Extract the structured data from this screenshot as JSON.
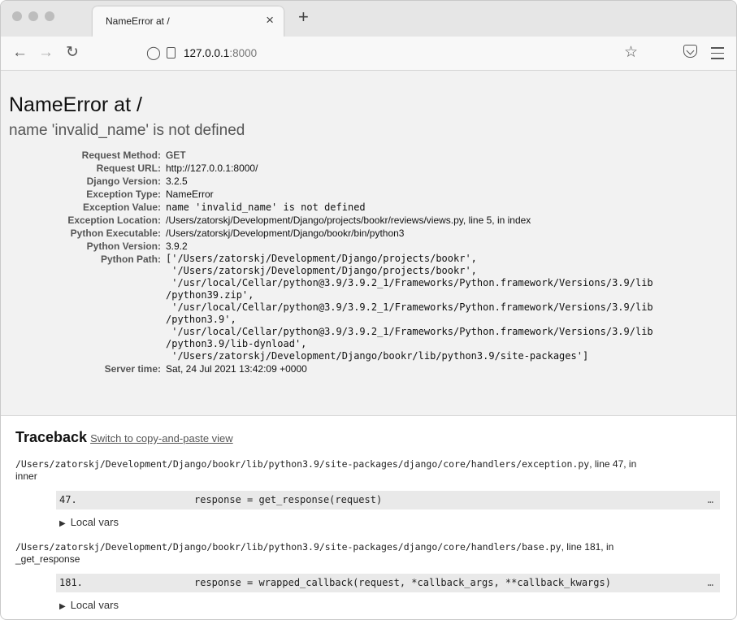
{
  "browser": {
    "tab_title": "NameError at /",
    "tab_close": "×",
    "new_tab": "+",
    "url_host": "127.0.0.1",
    "url_port": ":8000",
    "icons": [
      "back-arrow-icon",
      "forward-arrow-icon",
      "reload-icon",
      "shield-icon",
      "page-icon",
      "bookmark-star-icon",
      "pocket-icon",
      "hamburger-menu-icon"
    ]
  },
  "error": {
    "title": "NameError at /",
    "message": "name 'invalid_name' is not defined"
  },
  "meta": [
    {
      "label": "Request Method:",
      "value": "GET"
    },
    {
      "label": "Request URL:",
      "value": "http://127.0.0.1:8000/"
    },
    {
      "label": "Django Version:",
      "value": "3.2.5"
    },
    {
      "label": "Exception Type:",
      "value": "NameError"
    },
    {
      "label": "Exception Value:",
      "value": "name 'invalid_name' is not defined"
    },
    {
      "label": "Exception Location:",
      "value": "/Users/zatorskj/Development/Django/projects/bookr/reviews/views.py, line 5, in index"
    },
    {
      "label": "Python Executable:",
      "value": "/Users/zatorskj/Development/Django/bookr/bin/python3"
    },
    {
      "label": "Python Version:",
      "value": "3.9.2"
    },
    {
      "label": "Python Path:",
      "value": ""
    },
    {
      "label": "Server time:",
      "value": "Sat, 24 Jul 2021 13:42:09 +0000"
    }
  ],
  "python_path_lines": [
    "['/Users/zatorskj/Development/Django/projects/bookr',",
    " '/Users/zatorskj/Development/Django/projects/bookr',",
    " '/usr/local/Cellar/python@3.9/3.9.2_1/Frameworks/Python.framework/Versions/3.9/lib",
    "/python39.zip',",
    " '/usr/local/Cellar/python@3.9/3.9.2_1/Frameworks/Python.framework/Versions/3.9/lib",
    "/python3.9',",
    " '/usr/local/Cellar/python@3.9/3.9.2_1/Frameworks/Python.framework/Versions/3.9/lib",
    "/python3.9/lib-dynload',",
    " '/Users/zatorskj/Development/Django/bookr/lib/python3.9/site-packages']"
  ],
  "traceback": {
    "heading": "Traceback",
    "switch_link": "Switch to copy-and-paste view",
    "frames": [
      {
        "file": "/Users/zatorskj/Development/Django/bookr/lib/python3.9/site-packages/django/core/handlers/exception.py",
        "where_a": ", line 47, in",
        "where_b": "inner",
        "lineno": "47.",
        "code": "response = get_response(request)",
        "dots": "…",
        "locals": "Local vars"
      },
      {
        "file": "/Users/zatorskj/Development/Django/bookr/lib/python3.9/site-packages/django/core/handlers/base.py",
        "where_a": ", line 181, in",
        "where_b": "_get_response",
        "lineno": "181.",
        "code": "response = wrapped_callback(request, *callback_args, **callback_kwargs)",
        "dots": "…",
        "locals": "Local vars"
      }
    ]
  }
}
